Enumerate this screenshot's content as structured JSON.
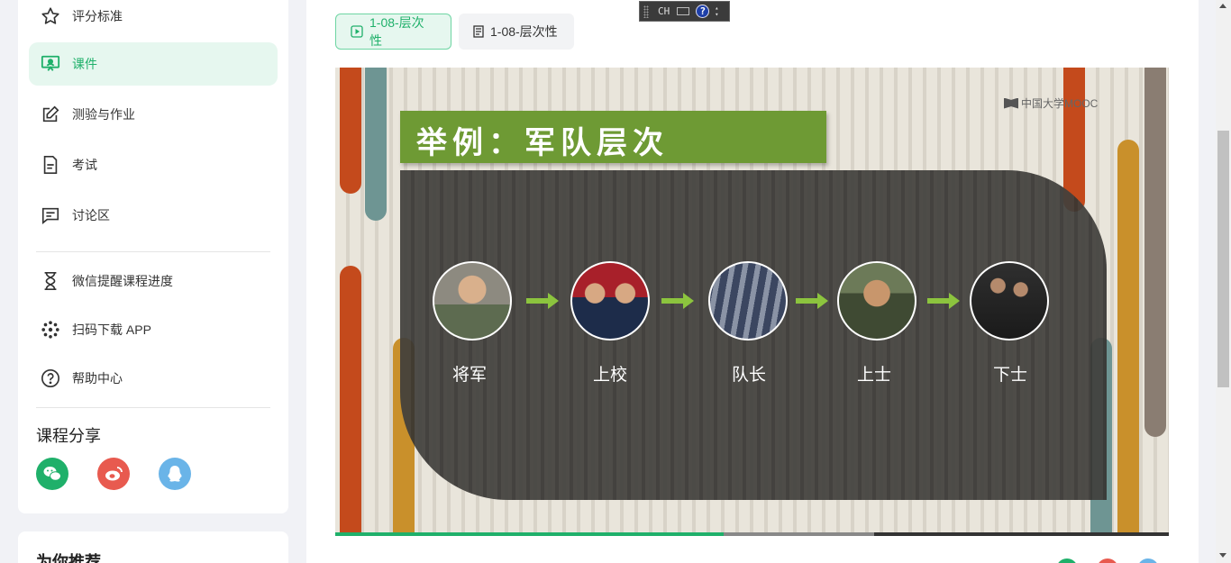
{
  "sidebar": {
    "items": [
      {
        "label": "评分标准",
        "icon": "star-icon"
      },
      {
        "label": "课件",
        "icon": "presentation-icon",
        "active": true
      },
      {
        "label": "测验与作业",
        "icon": "edit-icon"
      },
      {
        "label": "考试",
        "icon": "document-icon"
      },
      {
        "label": "讨论区",
        "icon": "chat-icon"
      },
      {
        "label": "微信提醒课程进度",
        "icon": "hourglass-icon"
      },
      {
        "label": "扫码下载 APP",
        "icon": "app-icon"
      },
      {
        "label": "帮助中心",
        "icon": "help-icon"
      }
    ],
    "share_title": "课程分享",
    "share_icons": [
      "wechat-icon",
      "weibo-icon",
      "qq-icon"
    ],
    "recommend_title": "为你推荐"
  },
  "tabs": [
    {
      "label": "1-08-层次性",
      "icon": "video-icon",
      "active": true
    },
    {
      "label": "1-08-层次性",
      "icon": "doc-icon",
      "active": false
    }
  ],
  "ime": {
    "mode": "CH",
    "help": "?"
  },
  "video": {
    "slide_title": "举例：军队层次",
    "watermark": "中国大学MOOC",
    "ranks": [
      "将军",
      "上校",
      "队长",
      "上士",
      "下士"
    ],
    "progress_played": 0.466,
    "progress_buffered": 0.647
  },
  "colors": {
    "accent": "#1fb06a",
    "slide_green": "#6e9a34",
    "wechat": "#1fb06a",
    "weibo": "#e85a4f",
    "qq": "#6ab4e8"
  }
}
